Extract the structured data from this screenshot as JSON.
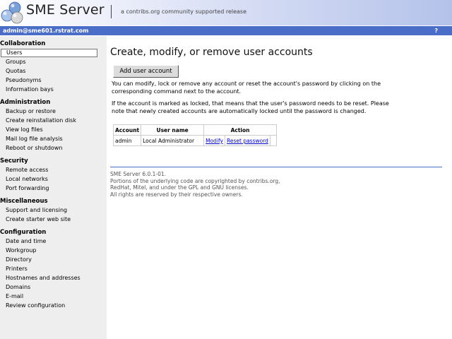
{
  "header": {
    "title": "SME Server",
    "tagline": "a contribs.org community supported release",
    "logo_icon": "sme-logo-icon"
  },
  "userbar": {
    "user": "admin@sme601.rstrat.com",
    "help": "?"
  },
  "sidebar": {
    "sections": [
      {
        "title": "Collaboration",
        "items": [
          "Users",
          "Groups",
          "Quotas",
          "Pseudonyms",
          "Information bays"
        ]
      },
      {
        "title": "Administration",
        "items": [
          "Backup or restore",
          "Create reinstallation disk",
          "View log files",
          "Mail log file analysis",
          "Reboot or shutdown"
        ]
      },
      {
        "title": "Security",
        "items": [
          "Remote access",
          "Local networks",
          "Port forwarding"
        ]
      },
      {
        "title": "Miscellaneous",
        "items": [
          "Support and licensing",
          "Create starter web site"
        ]
      },
      {
        "title": "Configuration",
        "items": [
          "Date and time",
          "Workgroup",
          "Directory",
          "Printers",
          "Hostnames and addresses",
          "Domains",
          "E-mail",
          "Review configuration"
        ]
      }
    ],
    "selected": "Users"
  },
  "main": {
    "title": "Create, modify, or remove user accounts",
    "add_button": "Add user account",
    "para1_line1": "You can modify, lock or remove any account or reset the account's password by clicking on the",
    "para1_line2": "corresponding command next to the account.",
    "para2_line1": "If the account is marked as locked, that means that the user's password needs to be reset. Please",
    "para2_line2": "note that newly created accounts are automatically locked until the password is changed.",
    "table": {
      "headers": [
        "Account",
        "User name",
        "Action"
      ],
      "rows": [
        {
          "account": "admin",
          "username": "Local Administrator",
          "action1": "Modify",
          "action2": "Reset password"
        }
      ]
    }
  },
  "footer": {
    "line1": "SME Server 6.0.1-01.",
    "line2": "Portions of the underlying code are copyrighted by contribs.org,",
    "line3": "RedHat, Mitel, and under the GPL and GNU licenses.",
    "line4": "All rights are reserved by their respective owners."
  }
}
